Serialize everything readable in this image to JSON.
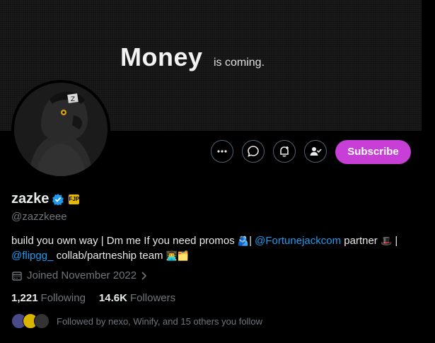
{
  "banner": {
    "headline": "Money",
    "subline": "is coming."
  },
  "actions": {
    "subscribe_label": "Subscribe"
  },
  "profile": {
    "name": "zazke",
    "handle": "@zazzkeee",
    "affiliate_badge_text": "FJP",
    "bio": {
      "part1": "build you own way | Dm me If you need promos ",
      "emoji1": "🫂",
      "part2": "| ",
      "mention1": "@Fortunejackcom",
      "part3": " partner ",
      "emoji2": "🎩",
      "part4": " | ",
      "mention2": "@flipgg_",
      "part5": " collab/partneship team ",
      "emoji3": "👨‍💻🗂️"
    },
    "joined": "Joined November 2022",
    "following_count": "1,221",
    "following_label": "Following",
    "followers_count": "14.6K",
    "followers_label": "Followers",
    "followed_by": "Followed by nexo, Winify, and 15 others you follow"
  },
  "colors": {
    "accent": "#c73fd6",
    "link": "#1d9bf0",
    "verified": "#1d9bf0"
  },
  "icons": [
    "more-icon",
    "message-icon",
    "notify-icon",
    "following-icon",
    "verified-icon",
    "calendar-icon",
    "chevron-right-icon"
  ]
}
